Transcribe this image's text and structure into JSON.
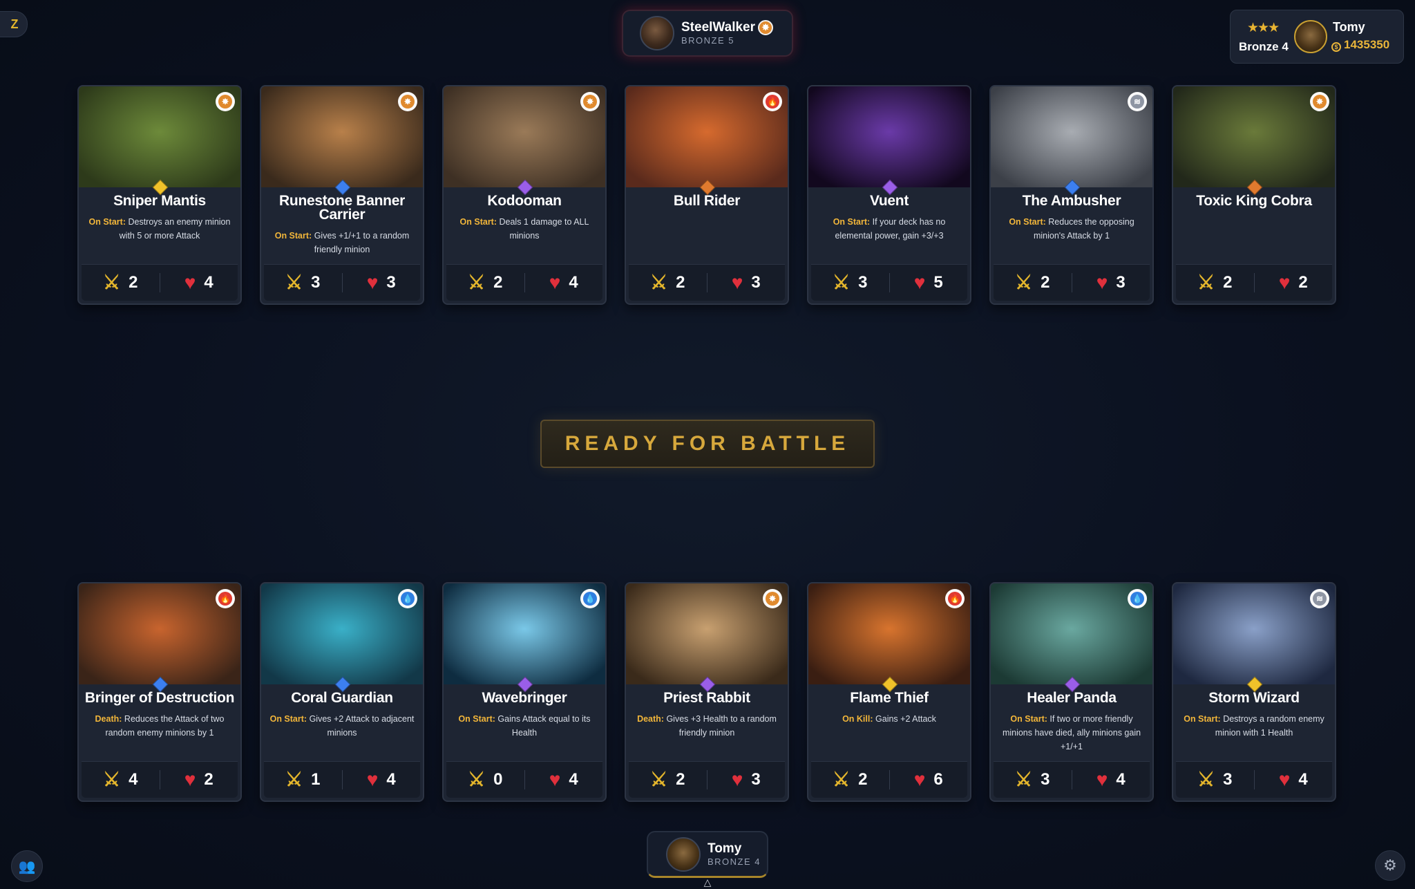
{
  "opponent": {
    "name": "SteelWalker",
    "rank": "BRONZE 5"
  },
  "self": {
    "name": "Tomy",
    "rank": "BRONZE 4"
  },
  "account": {
    "rank": "Bronze 4",
    "stars": "★★★",
    "name": "Tomy",
    "coins": "1435350"
  },
  "ready_button": "READY FOR BATTLE",
  "colors": {
    "fire": "#e03a30",
    "water": "#2f7fe0",
    "earth": "#e08a2e",
    "air": "#8e95a3",
    "gold": "#e3b52c",
    "health": "#e0303c"
  },
  "opponent_cards": [
    {
      "name": "Sniper Mantis",
      "keyword": "On Start:",
      "text": "Destroys an enemy minion with 5 or more Attack",
      "attack": "2",
      "health": "4",
      "element": "earth",
      "gem": "#f0c22a",
      "art": [
        "#6d8a3a",
        "#2d3a1a"
      ]
    },
    {
      "name": "Runestone Banner Carrier",
      "keyword": "On Start:",
      "text": "Gives +1/+1 to a random friendly minion",
      "attack": "3",
      "health": "3",
      "element": "earth",
      "gem": "#3c7ff0",
      "art": [
        "#b8804a",
        "#3a2a1c"
      ]
    },
    {
      "name": "Kodooman",
      "keyword": "On Start:",
      "text": "Deals 1 damage to ALL minions",
      "attack": "2",
      "health": "4",
      "element": "earth",
      "gem": "#9a5ee8",
      "art": [
        "#9a7a58",
        "#3e3024"
      ]
    },
    {
      "name": "Bull Rider",
      "keyword": "",
      "text": "",
      "attack": "2",
      "health": "3",
      "element": "fire",
      "gem": "#e07a2e",
      "art": [
        "#d66a2e",
        "#5a2a1c"
      ]
    },
    {
      "name": "Vuent",
      "keyword": "On Start:",
      "text": "If your deck has no elemental power, gain +3/+3",
      "attack": "3",
      "health": "5",
      "element": "",
      "gem": "#9a5ee8",
      "art": [
        "#6a3aa8",
        "#12081e"
      ]
    },
    {
      "name": "The Ambusher",
      "keyword": "On Start:",
      "text": "Reduces the opposing minion's Attack by 1",
      "attack": "2",
      "health": "3",
      "element": "air",
      "gem": "#3c7ff0",
      "art": [
        "#a8acb2",
        "#3c4048"
      ]
    },
    {
      "name": "Toxic King Cobra",
      "keyword": "",
      "text": "",
      "attack": "2",
      "health": "2",
      "element": "earth",
      "gem": "#e07a2e",
      "art": [
        "#6a7a3a",
        "#22281a"
      ]
    }
  ],
  "player_cards": [
    {
      "name": "Bringer of Destruction",
      "keyword": "Death:",
      "text": "Reduces the Attack of two random enemy minions by 1",
      "attack": "4",
      "health": "2",
      "element": "fire",
      "gem": "#3c7ff0",
      "art": [
        "#c8642e",
        "#3a2418"
      ]
    },
    {
      "name": "Coral Guardian",
      "keyword": "On Start:",
      "text": "Gives +2 Attack to adjacent minions",
      "attack": "1",
      "health": "4",
      "element": "water",
      "gem": "#3c7ff0",
      "art": [
        "#3ab0c8",
        "#123848"
      ]
    },
    {
      "name": "Wavebringer",
      "keyword": "On Start:",
      "text": "Gains Attack equal to its Health",
      "attack": "0",
      "health": "4",
      "element": "water",
      "gem": "#9a5ee8",
      "art": [
        "#7ac8e8",
        "#0e2c40"
      ]
    },
    {
      "name": "Priest Rabbit",
      "keyword": "Death:",
      "text": "Gives +3 Health to a random friendly minion",
      "attack": "2",
      "health": "3",
      "element": "earth",
      "gem": "#9a5ee8",
      "art": [
        "#c8a070",
        "#3a2a1a"
      ]
    },
    {
      "name": "Flame Thief",
      "keyword": "On Kill:",
      "text": "Gains +2 Attack",
      "attack": "2",
      "health": "6",
      "element": "fire",
      "gem": "#f0c22a",
      "art": [
        "#d8742e",
        "#3a1e12"
      ]
    },
    {
      "name": "Healer Panda",
      "keyword": "On Start:",
      "text": "If two or more friendly minions have died, ally minions gain +1/+1",
      "attack": "3",
      "health": "4",
      "element": "water",
      "gem": "#9a5ee8",
      "art": [
        "#6aa8a0",
        "#1c3a34"
      ]
    },
    {
      "name": "Storm Wizard",
      "keyword": "On Start:",
      "text": "Destroys a random enemy minion with 1 Health",
      "attack": "3",
      "health": "4",
      "element": "air",
      "gem": "#f0c22a",
      "art": [
        "#8aa0c8",
        "#1e2840"
      ]
    }
  ]
}
